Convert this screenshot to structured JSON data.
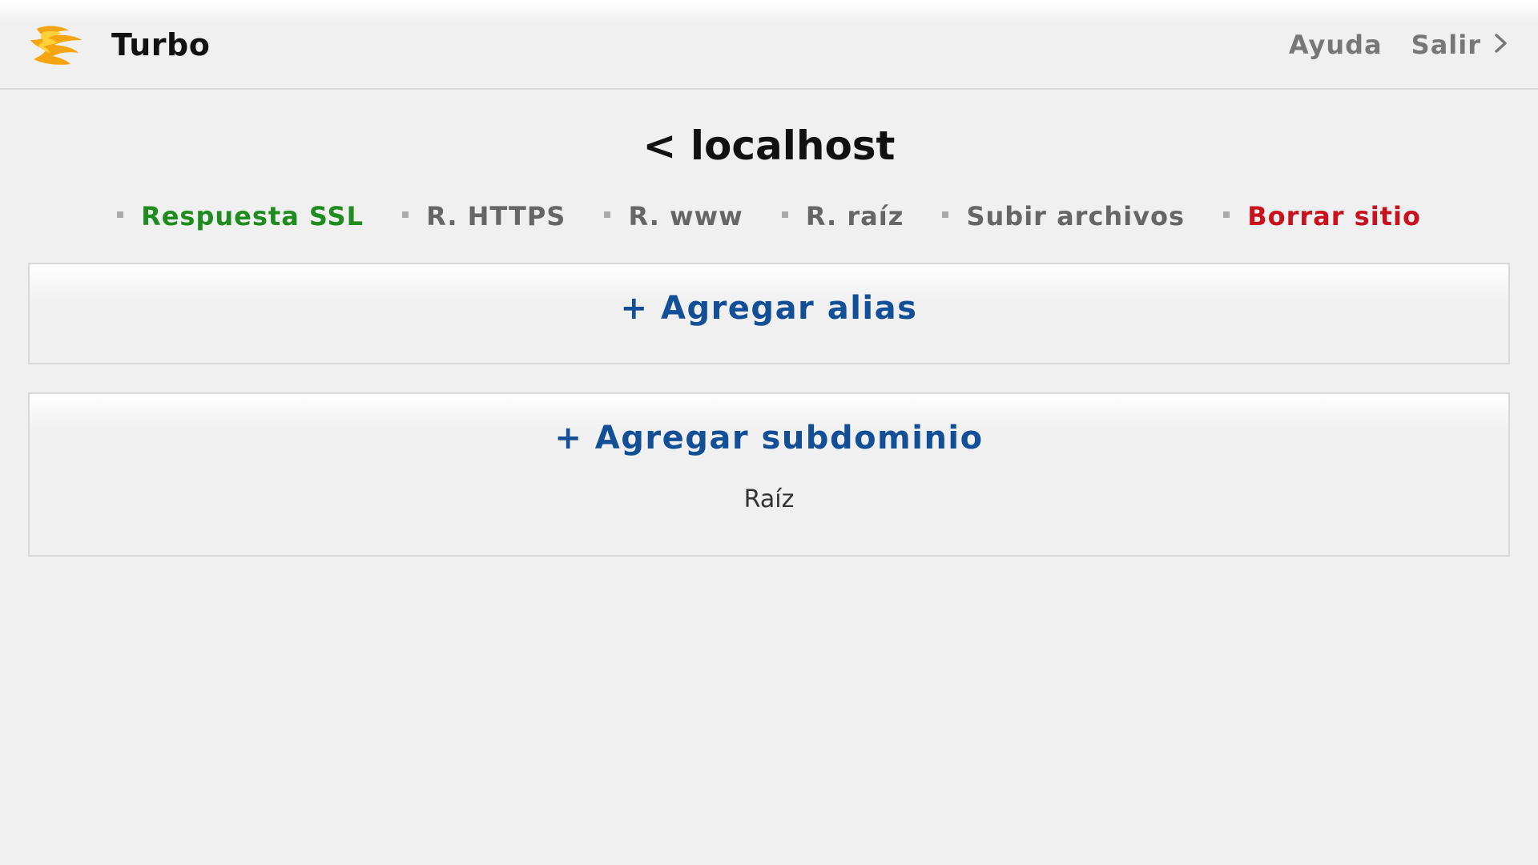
{
  "header": {
    "brand": "Turbo",
    "logo_icon": "flame-logo",
    "help_label": "Ayuda",
    "logout_label": "Salir",
    "logout_icon": "chevron-right-icon"
  },
  "site": {
    "title": "localhost",
    "back_glyph": "<"
  },
  "actions": [
    {
      "label": "Respuesta SSL",
      "color": "#1f8c1f"
    },
    {
      "label": "R. HTTPS",
      "color": "#666666"
    },
    {
      "label": "R. www",
      "color": "#666666"
    },
    {
      "label": "R. raíz",
      "color": "#666666"
    },
    {
      "label": "Subir archivos",
      "color": "#666666"
    },
    {
      "label": "Borrar sitio",
      "color": "#c8121e"
    }
  ],
  "alias_panel": {
    "add_label": "+ Agregar alias"
  },
  "subdomain_panel": {
    "add_label": "+ Agregar subdominio",
    "items": [
      "Raíz"
    ]
  },
  "colors": {
    "background": "#f0f0f0",
    "link_blue": "#124f97",
    "success_green": "#1f8c1f",
    "danger_red": "#c8121e"
  }
}
